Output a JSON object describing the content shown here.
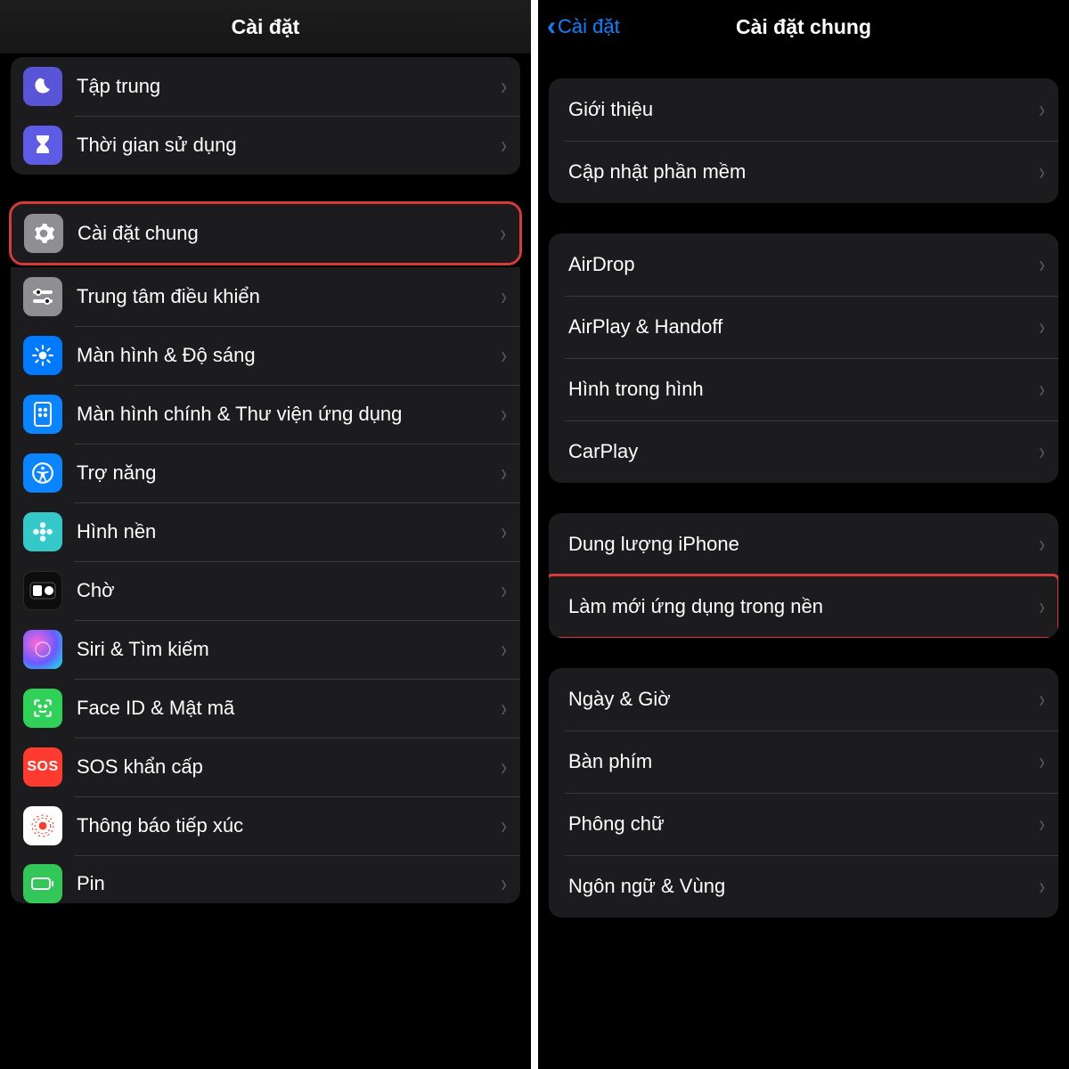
{
  "left": {
    "title": "Cài đặt",
    "group1": [
      {
        "label": "Tập trung"
      },
      {
        "label": "Thời gian sử dụng"
      }
    ],
    "highlight": {
      "label": "Cài đặt chung"
    },
    "group2": [
      {
        "label": "Trung tâm điều khiển"
      },
      {
        "label": "Màn hình & Độ sáng"
      },
      {
        "label": "Màn hình chính & Thư viện ứng dụng"
      },
      {
        "label": "Trợ năng"
      },
      {
        "label": "Hình nền"
      },
      {
        "label": "Chờ"
      },
      {
        "label": "Siri & Tìm kiếm"
      },
      {
        "label": "Face ID & Mật mã"
      },
      {
        "label": "SOS khẩn cấp"
      },
      {
        "label": "Thông báo tiếp xúc"
      },
      {
        "label": "Pin"
      }
    ]
  },
  "right": {
    "back": "Cài đặt",
    "title": "Cài đặt chung",
    "g1": [
      {
        "label": "Giới thiệu"
      },
      {
        "label": "Cập nhật phần mềm"
      }
    ],
    "g2": [
      {
        "label": "AirDrop"
      },
      {
        "label": "AirPlay & Handoff"
      },
      {
        "label": "Hình trong hình"
      },
      {
        "label": "CarPlay"
      }
    ],
    "g3": [
      {
        "label": "Dung lượng iPhone"
      },
      {
        "label": "Làm mới ứng dụng trong nền",
        "hl": true
      }
    ],
    "g4": [
      {
        "label": "Ngày & Giờ"
      },
      {
        "label": "Bàn phím"
      },
      {
        "label": "Phông chữ"
      },
      {
        "label": "Ngôn ngữ & Vùng"
      }
    ]
  }
}
